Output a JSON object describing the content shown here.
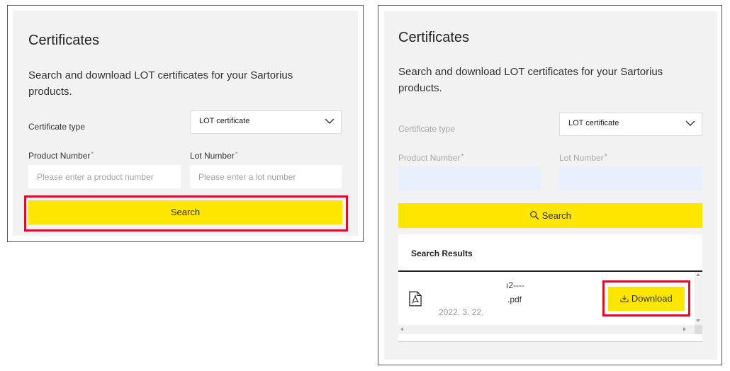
{
  "left": {
    "title": "Certificates",
    "description": "Search and download LOT certificates for your Sartorius products.",
    "certificate_type_label": "Certificate type",
    "certificate_type_value": "LOT certificate",
    "product_number_label": "Product Number",
    "lot_number_label": "Lot Number",
    "required_mark": "*",
    "product_placeholder": "Please enter a product number",
    "lot_placeholder": "Please enter a lot number",
    "search_label": "Search"
  },
  "right": {
    "title": "Certificates",
    "description": "Search and download LOT certificates for your Sartorius products.",
    "certificate_type_label": "Certificate type",
    "certificate_type_value": "LOT certificate",
    "product_number_label": "Product Number",
    "lot_number_label": "Lot Number",
    "required_mark": "*",
    "search_label": "Search",
    "results_heading": "Search Results",
    "file": {
      "name_line1": "ı2----",
      "name_line2": ".pdf",
      "date": "2022. 3. 22."
    },
    "download_label": "Download"
  },
  "colors": {
    "accent_yellow": "#ffe600",
    "highlight_red": "#d6122b",
    "panel_bg": "#f2f2f2",
    "input_blue": "#e9f0fd"
  },
  "icons": [
    "chevron-down-icon",
    "search-icon",
    "pdf-file-icon",
    "download-icon",
    "scroll-arrow-icon"
  ]
}
